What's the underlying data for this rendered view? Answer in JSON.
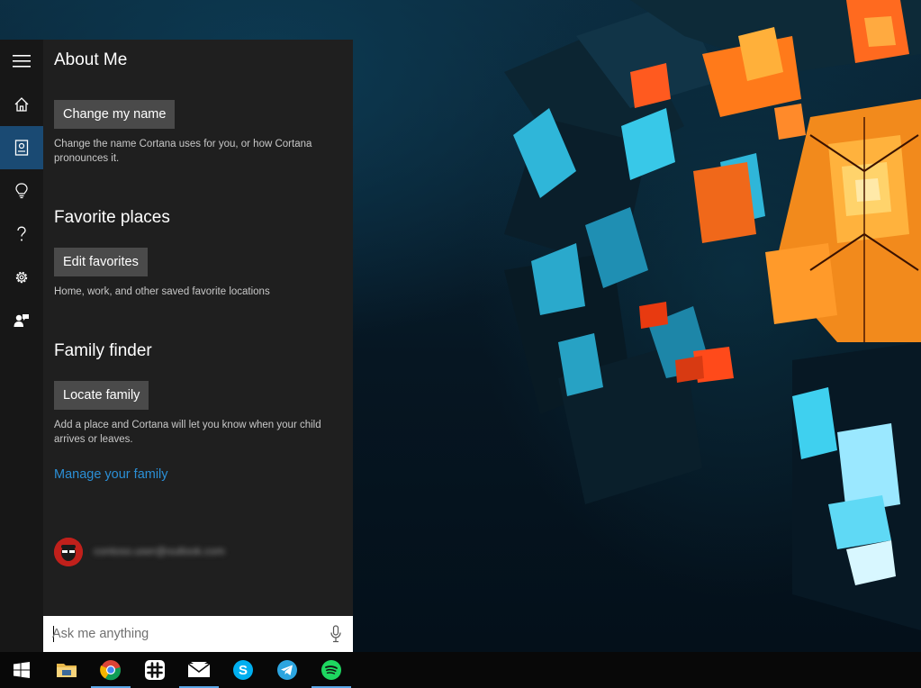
{
  "panel": {
    "rail": {
      "items": [
        {
          "icon": "hamburger-menu-icon"
        },
        {
          "icon": "home-icon"
        },
        {
          "icon": "notebook-icon",
          "active": true
        },
        {
          "icon": "lightbulb-icon"
        },
        {
          "icon": "help-icon"
        },
        {
          "icon": "gear-icon"
        },
        {
          "icon": "feedback-icon"
        }
      ]
    },
    "about_me": {
      "title": "About Me",
      "button": "Change my name",
      "description": "Change the name Cortana uses for you, or how Cortana pronounces it."
    },
    "favorite_places": {
      "title": "Favorite places",
      "button": "Edit favorites",
      "description": "Home, work, and other saved favorite locations"
    },
    "family_finder": {
      "title": "Family finder",
      "button": "Locate family",
      "description": "Add a place and Cortana will let you know when your child arrives or leaves.",
      "link": "Manage your family"
    },
    "account": {
      "email": "contoso.user@outlook.com"
    },
    "search": {
      "placeholder": "Ask me anything"
    }
  },
  "taskbar": {
    "items": [
      {
        "icon": "windows-start-icon"
      },
      {
        "icon": "file-explorer-icon"
      },
      {
        "icon": "chrome-icon",
        "running": true
      },
      {
        "icon": "slack-icon"
      },
      {
        "icon": "mail-icon",
        "running": true
      },
      {
        "icon": "skype-icon"
      },
      {
        "icon": "telegram-icon"
      },
      {
        "icon": "spotify-icon",
        "running": true
      }
    ]
  },
  "colors": {
    "accent": "#1a4a73",
    "link": "#2b8fd6",
    "panel_bg": "#1f1f1f",
    "rail_bg": "#171717"
  }
}
